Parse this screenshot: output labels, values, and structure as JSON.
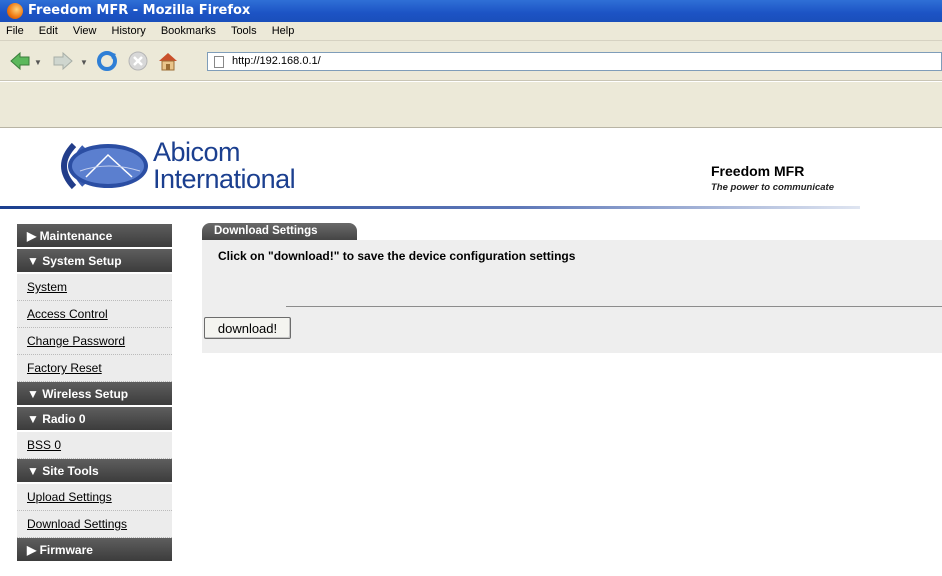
{
  "window": {
    "title": "Freedom MFR - Mozilla Firefox"
  },
  "menu": [
    "File",
    "Edit",
    "View",
    "History",
    "Bookmarks",
    "Tools",
    "Help"
  ],
  "browser": {
    "url": "http://192.168.0.1/"
  },
  "header": {
    "brand_line1": "Abicom",
    "brand_line2": "International",
    "product": "Freedom MFR",
    "tagline": "The power to communicate"
  },
  "sidebar": {
    "items": [
      {
        "type": "section",
        "label": "▶ Maintenance"
      },
      {
        "type": "section",
        "label": "▼ System Setup"
      },
      {
        "type": "link",
        "label": "System"
      },
      {
        "type": "link",
        "label": "Access Control"
      },
      {
        "type": "link",
        "label": "Change Password"
      },
      {
        "type": "link",
        "label": "Factory Reset"
      },
      {
        "type": "section",
        "label": "▼ Wireless Setup"
      },
      {
        "type": "section",
        "label": "▼ Radio 0"
      },
      {
        "type": "link",
        "label": "BSS 0"
      },
      {
        "type": "section",
        "label": "▼ Site Tools"
      },
      {
        "type": "link",
        "label": "Upload Settings"
      },
      {
        "type": "link",
        "label": "Download Settings"
      },
      {
        "type": "section",
        "label": "▶ Firmware"
      }
    ]
  },
  "main": {
    "tab_label": "Download Settings",
    "instruction": "Click on \"download!\" to save the device configuration settings",
    "download_button": "download!"
  }
}
